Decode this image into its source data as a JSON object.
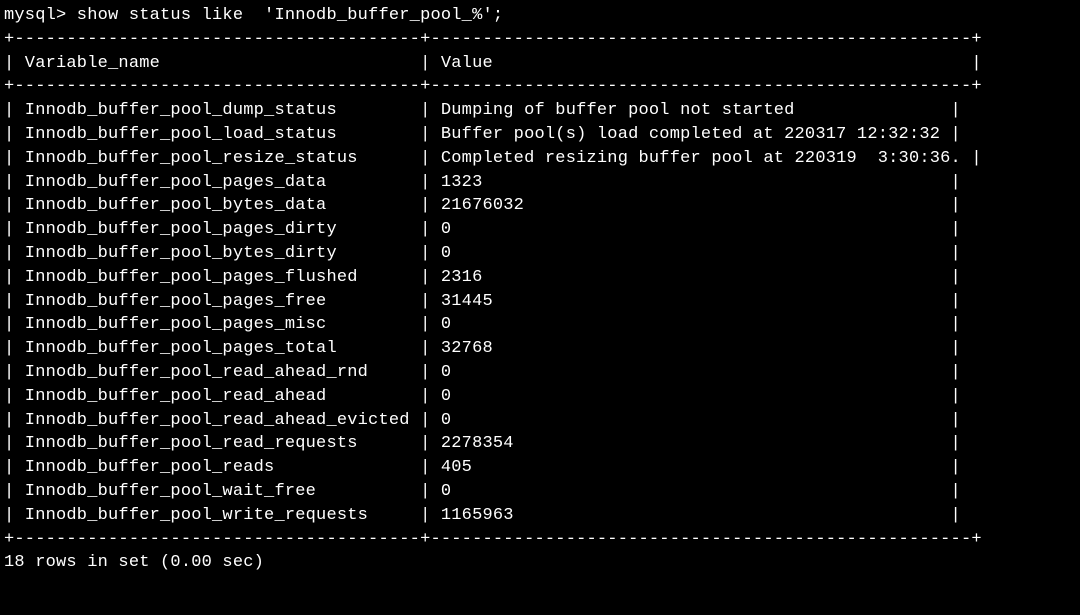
{
  "prompt": "mysql> show status like  'Innodb_buffer_pool_%';",
  "header": {
    "col1": "Variable_name",
    "col2": "Value"
  },
  "rows": [
    {
      "name": "Innodb_buffer_pool_dump_status",
      "name_padded": "Innodb_buffer_pool_dump_status       ",
      "value": "Dumping of buffer pool not started              "
    },
    {
      "name": "Innodb_buffer_pool_load_status",
      "name_padded": "Innodb_buffer_pool_load_status       ",
      "value": "Buffer pool(s) load completed at 220317 12:32:32"
    },
    {
      "name": "Innodb_buffer_pool_resize_status",
      "name_padded": "Innodb_buffer_pool_resize_status     ",
      "value": "Completed resizing buffer pool at 220319  3:30:36."
    },
    {
      "name": "Innodb_buffer_pool_pages_data",
      "name_padded": "Innodb_buffer_pool_pages_data        ",
      "value": "1323                                            "
    },
    {
      "name": "Innodb_buffer_pool_bytes_data",
      "name_padded": "Innodb_buffer_pool_bytes_data        ",
      "value": "21676032                                        "
    },
    {
      "name": "Innodb_buffer_pool_pages_dirty",
      "name_padded": "Innodb_buffer_pool_pages_dirty       ",
      "value": "0                                               "
    },
    {
      "name": "Innodb_buffer_pool_bytes_dirty",
      "name_padded": "Innodb_buffer_pool_bytes_dirty       ",
      "value": "0                                               "
    },
    {
      "name": "Innodb_buffer_pool_pages_flushed",
      "name_padded": "Innodb_buffer_pool_pages_flushed     ",
      "value": "2316                                            "
    },
    {
      "name": "Innodb_buffer_pool_pages_free",
      "name_padded": "Innodb_buffer_pool_pages_free        ",
      "value": "31445                                           "
    },
    {
      "name": "Innodb_buffer_pool_pages_misc",
      "name_padded": "Innodb_buffer_pool_pages_misc        ",
      "value": "0                                               "
    },
    {
      "name": "Innodb_buffer_pool_pages_total",
      "name_padded": "Innodb_buffer_pool_pages_total       ",
      "value": "32768                                           "
    },
    {
      "name": "Innodb_buffer_pool_read_ahead_rnd",
      "name_padded": "Innodb_buffer_pool_read_ahead_rnd    ",
      "value": "0                                               "
    },
    {
      "name": "Innodb_buffer_pool_read_ahead",
      "name_padded": "Innodb_buffer_pool_read_ahead        ",
      "value": "0                                               "
    },
    {
      "name": "Innodb_buffer_pool_read_ahead_evicted",
      "name_padded": "Innodb_buffer_pool_read_ahead_evicted",
      "value": "0                                               "
    },
    {
      "name": "Innodb_buffer_pool_read_requests",
      "name_padded": "Innodb_buffer_pool_read_requests     ",
      "value": "2278354                                         "
    },
    {
      "name": "Innodb_buffer_pool_reads",
      "name_padded": "Innodb_buffer_pool_reads             ",
      "value": "405                                             "
    },
    {
      "name": "Innodb_buffer_pool_wait_free",
      "name_padded": "Innodb_buffer_pool_wait_free         ",
      "value": "0                                               "
    },
    {
      "name": "Innodb_buffer_pool_write_requests",
      "name_padded": "Innodb_buffer_pool_write_requests    ",
      "value": "1165963                                         "
    }
  ],
  "footer": "18 rows in set (0.00 sec)",
  "border": "+---------------------------------------+----------------------------------------------------+",
  "header_line": "| Variable_name                         | Value                                              |",
  "chart_data": {
    "type": "table",
    "title": "MySQL InnoDB Buffer Pool Status",
    "columns": [
      "Variable_name",
      "Value"
    ],
    "data": [
      [
        "Innodb_buffer_pool_dump_status",
        "Dumping of buffer pool not started"
      ],
      [
        "Innodb_buffer_pool_load_status",
        "Buffer pool(s) load completed at 220317 12:32:32"
      ],
      [
        "Innodb_buffer_pool_resize_status",
        "Completed resizing buffer pool at 220319  3:30:36."
      ],
      [
        "Innodb_buffer_pool_pages_data",
        "1323"
      ],
      [
        "Innodb_buffer_pool_bytes_data",
        "21676032"
      ],
      [
        "Innodb_buffer_pool_pages_dirty",
        "0"
      ],
      [
        "Innodb_buffer_pool_bytes_dirty",
        "0"
      ],
      [
        "Innodb_buffer_pool_pages_flushed",
        "2316"
      ],
      [
        "Innodb_buffer_pool_pages_free",
        "31445"
      ],
      [
        "Innodb_buffer_pool_pages_misc",
        "0"
      ],
      [
        "Innodb_buffer_pool_pages_total",
        "32768"
      ],
      [
        "Innodb_buffer_pool_read_ahead_rnd",
        "0"
      ],
      [
        "Innodb_buffer_pool_read_ahead",
        "0"
      ],
      [
        "Innodb_buffer_pool_read_ahead_evicted",
        "0"
      ],
      [
        "Innodb_buffer_pool_read_requests",
        "2278354"
      ],
      [
        "Innodb_buffer_pool_reads",
        "405"
      ],
      [
        "Innodb_buffer_pool_wait_free",
        "0"
      ],
      [
        "Innodb_buffer_pool_write_requests",
        "1165963"
      ]
    ]
  }
}
